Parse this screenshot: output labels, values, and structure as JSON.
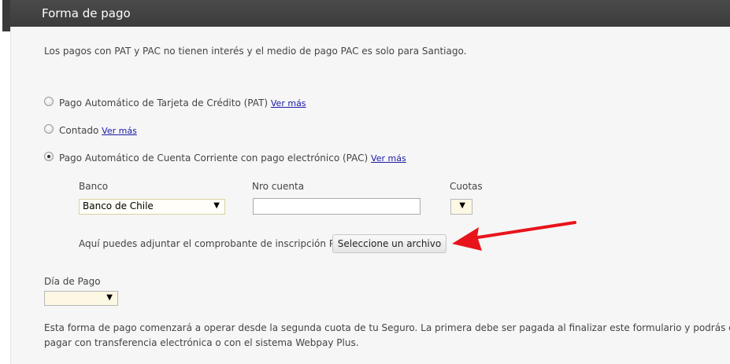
{
  "header": {
    "title": "Forma de pago"
  },
  "info_text": "Los pagos con PAT y PAC no tienen interés y el medio de pago PAC es solo para Santiago.",
  "payment_options": [
    {
      "label": "Pago Automático de Tarjeta de Crédito (PAT)",
      "link": "Ver más",
      "selected": false
    },
    {
      "label": "Contado",
      "link": "Ver más",
      "selected": false
    },
    {
      "label": "Pago Automático de Cuenta Corriente con pago electrónico (PAC)",
      "link": "Ver más",
      "selected": true
    }
  ],
  "pac_form": {
    "banco_label": "Banco",
    "banco_value": "Banco de Chile",
    "cuenta_label": "Nro cuenta",
    "cuenta_value": "",
    "cuotas_label": "Cuotas",
    "cuotas_value": "",
    "attach_label": "Aquí puedes adjuntar el comprobante de inscripción PAC",
    "file_button": "Seleccione un archivo"
  },
  "dia_pago": {
    "label": "Día de Pago",
    "value": ""
  },
  "footer_text_1": "Esta forma de pago comenzará a operar desde la segunda cuota de tu Seguro. La primera debe ser pagada al finalizar este formulario y podrás elegir",
  "footer_text_2": "pagar con transferencia electrónica o con el sistema Webpay Plus.",
  "colors": {
    "header_bg": "#3c3c3c",
    "content_bg": "#f6f6f6",
    "annotation_arrow": "#e8141b",
    "highlight_field": "#fdf8e4"
  },
  "icons": {
    "dropdown": "dropdown-triangle-icon",
    "annotation": "red-arrow-icon"
  }
}
